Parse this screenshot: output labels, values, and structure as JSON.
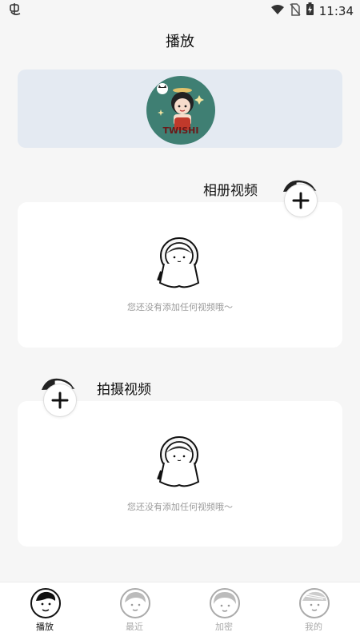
{
  "status_bar": {
    "left_icon": "app-bug-icon",
    "time": "11:34",
    "icons": [
      "wifi-icon",
      "no-sim-icon",
      "battery-charging-icon"
    ]
  },
  "header": {
    "title": "播放"
  },
  "banner": {
    "avatar_text": "TWISHI"
  },
  "album_section": {
    "title": "相册视频",
    "empty_text": "您还没有添加任何视频哦～"
  },
  "shoot_section": {
    "title": "拍摄视频",
    "empty_text": "您还没有添加任何视频哦～"
  },
  "bottom_nav": {
    "items": [
      {
        "label": "播放",
        "active": true,
        "icon": "boy-face-icon"
      },
      {
        "label": "最近",
        "active": false,
        "icon": "girl-face-icon"
      },
      {
        "label": "加密",
        "active": false,
        "icon": "curly-girl-face-icon"
      },
      {
        "label": "我的",
        "active": false,
        "icon": "bandana-face-icon"
      }
    ]
  }
}
